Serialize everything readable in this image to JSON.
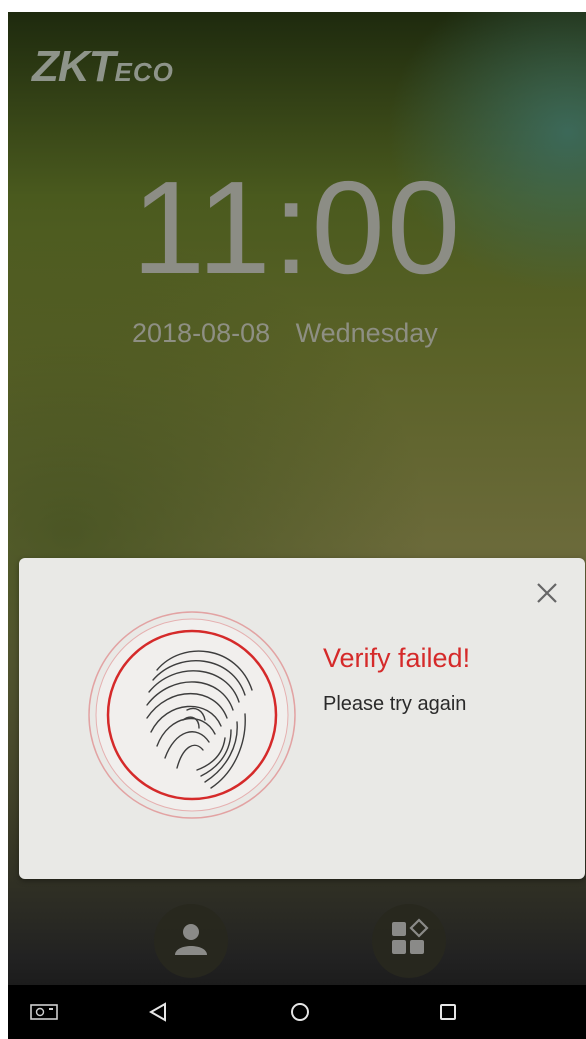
{
  "brand": {
    "logo_main": "ZKT",
    "logo_sub": "ECO"
  },
  "clock": {
    "time": "11:00",
    "date": "2018-08-08",
    "weekday": "Wednesday"
  },
  "dialog": {
    "title": "Verify failed!",
    "message": "Please try again",
    "close_icon": "close-icon",
    "fingerprint_icon": "fingerprint-icon",
    "accent_color": "#d52a2a"
  },
  "bottom_actions": [
    {
      "name": "user-verify-button",
      "icon": "person-icon"
    },
    {
      "name": "menu-button",
      "icon": "apps-icon"
    }
  ],
  "navbar": [
    "screenshot-icon",
    "back-icon",
    "home-icon",
    "recents-icon"
  ]
}
